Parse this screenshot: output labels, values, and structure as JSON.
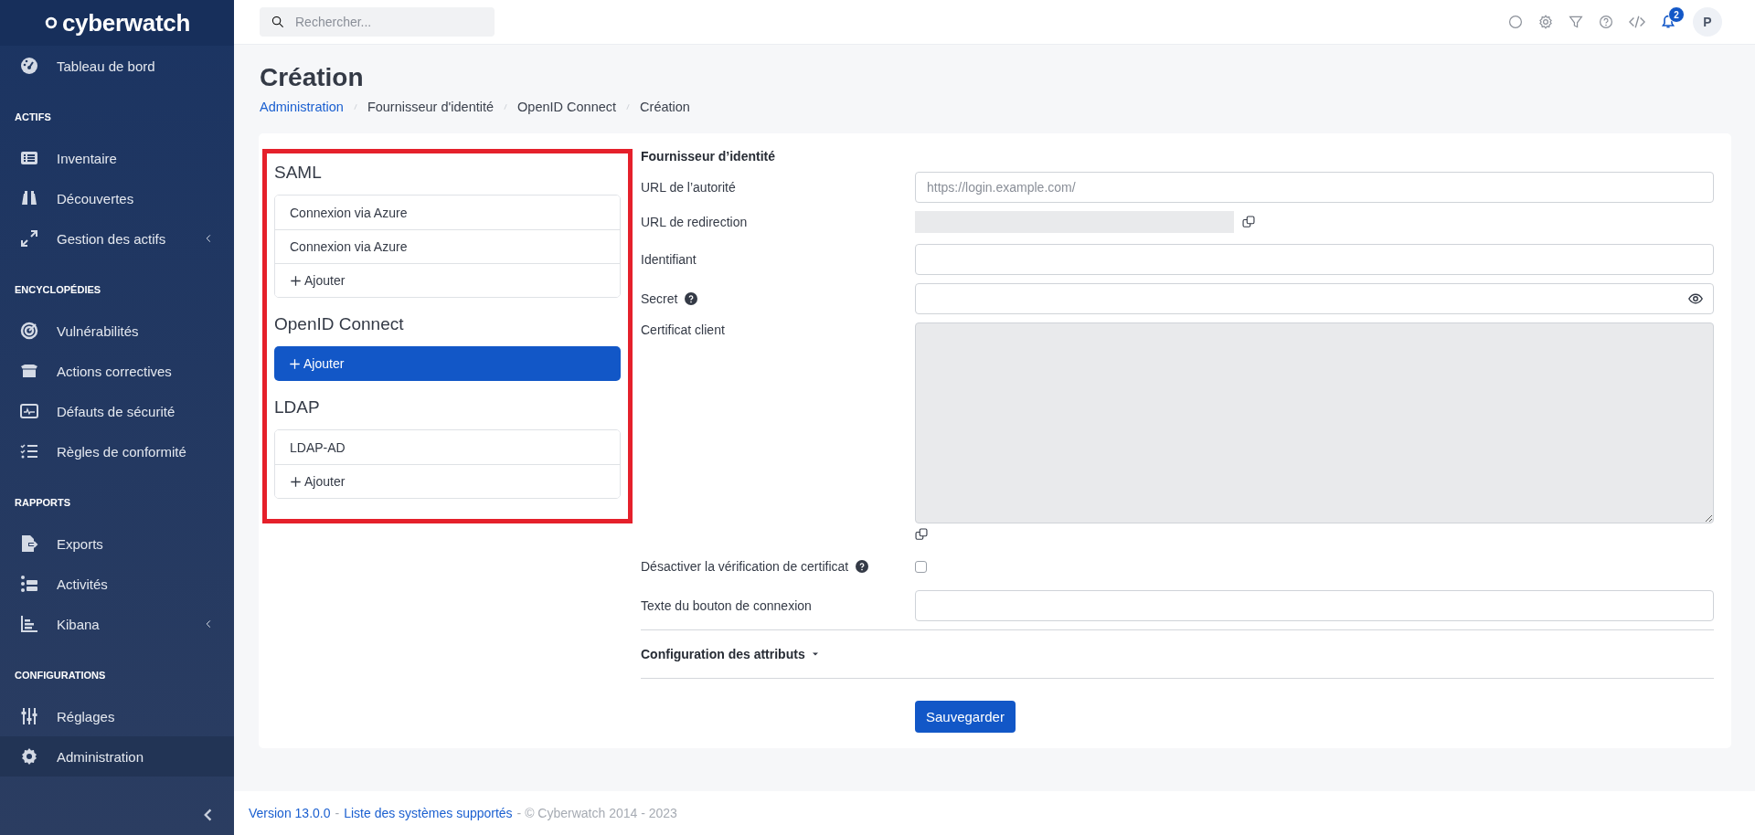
{
  "logo": {
    "text": "cyberwatch"
  },
  "sidebar": {
    "groups": [
      {
        "items": [
          {
            "label": "Tableau de bord",
            "selected": false,
            "expandable": false
          }
        ]
      },
      {
        "heading": "ACTIFS",
        "items": [
          {
            "label": "Inventaire",
            "selected": false,
            "expandable": false
          },
          {
            "label": "Découvertes",
            "selected": false,
            "expandable": false
          },
          {
            "label": "Gestion des actifs",
            "selected": false,
            "expandable": true
          }
        ]
      },
      {
        "heading": "ENCYCLOPÉDIES",
        "items": [
          {
            "label": "Vulnérabilités",
            "selected": false,
            "expandable": false
          },
          {
            "label": "Actions correctives",
            "selected": false,
            "expandable": false
          },
          {
            "label": "Défauts de sécurité",
            "selected": false,
            "expandable": false
          },
          {
            "label": "Règles de conformité",
            "selected": false,
            "expandable": false
          }
        ]
      },
      {
        "heading": "RAPPORTS",
        "items": [
          {
            "label": "Exports",
            "selected": false,
            "expandable": false
          },
          {
            "label": "Activités",
            "selected": false,
            "expandable": false
          },
          {
            "label": "Kibana",
            "selected": false,
            "expandable": true
          }
        ]
      },
      {
        "heading": "CONFIGURATIONS",
        "items": [
          {
            "label": "Réglages",
            "selected": false,
            "expandable": false
          },
          {
            "label": "Administration",
            "selected": true,
            "expandable": false
          }
        ]
      }
    ]
  },
  "topbar": {
    "search": {
      "placeholder": "Rechercher..."
    },
    "notifications": {
      "count": "2"
    },
    "avatar": {
      "initial": "P"
    }
  },
  "page": {
    "title": "Création",
    "breadcrumb": [
      {
        "label": "Administration",
        "link": true
      },
      {
        "label": "Fournisseur d'identité",
        "link": false
      },
      {
        "label": "OpenID Connect",
        "link": false
      },
      {
        "label": "Création",
        "link": false
      }
    ]
  },
  "providers": {
    "sections": [
      {
        "title": "SAML",
        "items": [
          {
            "label": "Connexion via Azure",
            "kind": "entry",
            "selected": false
          },
          {
            "label": "Connexion via Azure",
            "kind": "entry",
            "selected": false
          },
          {
            "label": "Ajouter",
            "kind": "add",
            "selected": false
          }
        ]
      },
      {
        "title": "OpenID Connect",
        "items": [
          {
            "label": "Ajouter",
            "kind": "add",
            "selected": true
          }
        ]
      },
      {
        "title": "LDAP",
        "items": [
          {
            "label": "LDAP-AD",
            "kind": "entry",
            "selected": false
          },
          {
            "label": "Ajouter",
            "kind": "add",
            "selected": false
          }
        ]
      }
    ]
  },
  "form": {
    "heading": "Fournisseur d’identité",
    "fields": [
      {
        "label": "URL de l’autorité",
        "kind": "text",
        "placeholder": "https://login.example.com/",
        "help": false,
        "copy": false
      },
      {
        "label": "URL de redirection",
        "kind": "readonly",
        "help": false,
        "copy": true
      },
      {
        "label": "Identifiant",
        "kind": "text",
        "help": false,
        "copy": false
      },
      {
        "label": "Secret",
        "kind": "password",
        "help": true,
        "copy": false
      },
      {
        "label": "Certificat client",
        "kind": "textarea",
        "help": false,
        "copy": true
      },
      {
        "label": "Désactiver la vérification de certificat",
        "kind": "checkbox",
        "help": true,
        "copy": false,
        "checked": false
      },
      {
        "label": "Texte du bouton de connexion",
        "kind": "text",
        "help": false,
        "copy": false
      }
    ],
    "section": {
      "title": "Configuration des attributs",
      "expanded": false
    },
    "submit": "Sauvegarder"
  },
  "footer": {
    "parts": [
      {
        "text": "Version 13.0.0",
        "link": true
      },
      {
        "text": "-",
        "link": false
      },
      {
        "text": "Liste des systèmes supportés",
        "link": true
      },
      {
        "text": "- © Cyberwatch 2014 - 2023",
        "link": false
      }
    ]
  }
}
